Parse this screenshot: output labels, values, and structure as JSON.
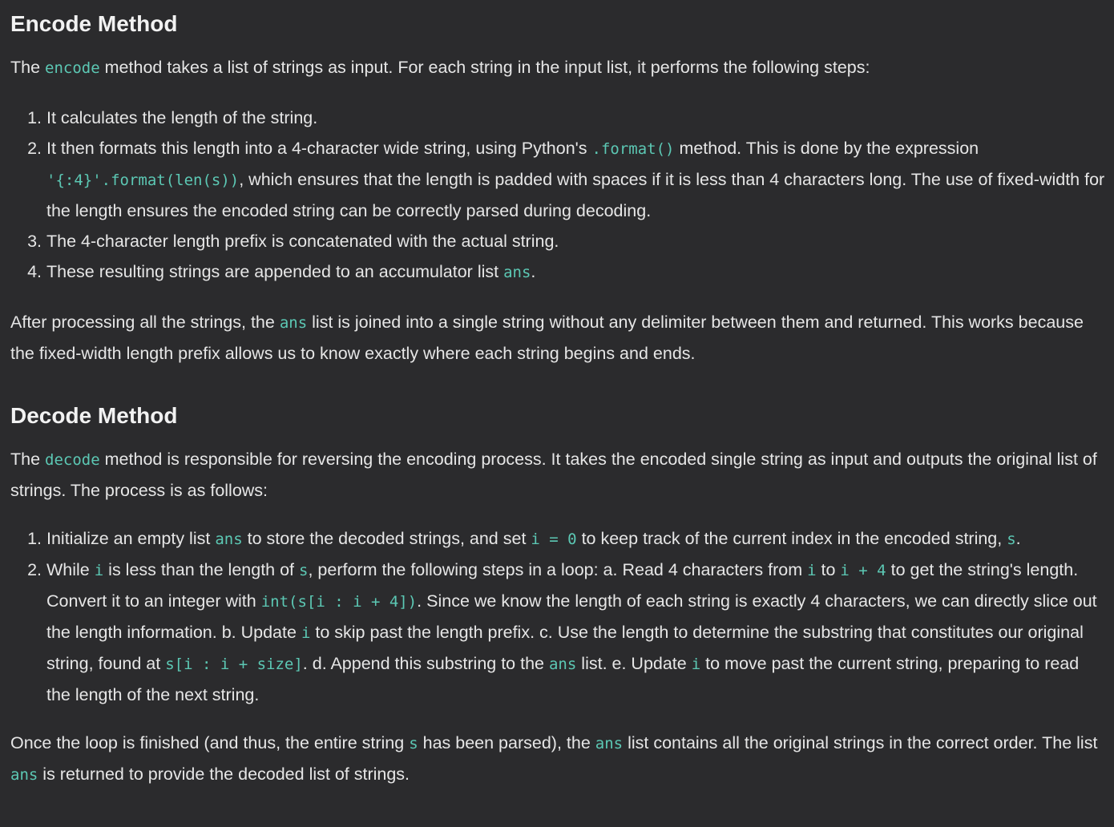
{
  "encode": {
    "heading": "Encode Method",
    "intro": {
      "t1": "The ",
      "c1": "encode",
      "t2": " method takes a list of strings as input. For each string in the input list, it performs the following steps:"
    },
    "steps": [
      {
        "t1": "It calculates the length of the string."
      },
      {
        "t1": "It then formats this length into a 4-character wide string, using Python's ",
        "c1": ".format()",
        "t2": " method. This is done by the expression ",
        "c2": "'{:4}'.format(len(s))",
        "t3": ", which ensures that the length is padded with spaces if it is less than 4 characters long. The use of fixed-width for the length ensures the encoded string can be correctly parsed during decoding."
      },
      {
        "t1": "The 4-character length prefix is concatenated with the actual string."
      },
      {
        "t1": "These resulting strings are appended to an accumulator list ",
        "c1": "ans",
        "t2": "."
      }
    ],
    "after": {
      "t1": "After processing all the strings, the ",
      "c1": "ans",
      "t2": " list is joined into a single string without any delimiter between them and returned. This works because the fixed-width length prefix allows us to know exactly where each string begins and ends."
    }
  },
  "decode": {
    "heading": "Decode Method",
    "intro": {
      "t1": "The ",
      "c1": "decode",
      "t2": " method is responsible for reversing the encoding process. It takes the encoded single string as input and outputs the original list of strings. The process is as follows:"
    },
    "steps": [
      {
        "t1": "Initialize an empty list ",
        "c1": "ans",
        "t2": " to store the decoded strings, and set ",
        "c2": "i = 0",
        "t3": " to keep track of the current index in the encoded string, ",
        "c3": "s",
        "t4": "."
      },
      {
        "t1": "While ",
        "c1": "i",
        "t2": " is less than the length of ",
        "c2": "s",
        "t3": ", perform the following steps in a loop: a. Read 4 characters from ",
        "c3": "i",
        "t4": " to ",
        "c4": "i + 4",
        "t5": " to get the string's length. Convert it to an integer with ",
        "c5": "int(s[i : i + 4])",
        "t6": ". Since we know the length of each string is exactly 4 characters, we can directly slice out the length information. b. Update ",
        "c6": "i",
        "t7": " to skip past the length prefix. c. Use the length to determine the substring that constitutes our original string, found at ",
        "c7": "s[i : i + size]",
        "t8": ". d. Append this substring to the ",
        "c8": "ans",
        "t9": " list. e. Update ",
        "c9": "i",
        "t10": " to move past the current string, preparing to read the length of the next string."
      }
    ],
    "after": {
      "t1": "Once the loop is finished (and thus, the entire string ",
      "c1": "s",
      "t2": " has been parsed), the ",
      "c2": "ans",
      "t3": " list contains all the original strings in the correct order. The list ",
      "c3": "ans",
      "t4": " is returned to provide the decoded list of strings."
    }
  }
}
